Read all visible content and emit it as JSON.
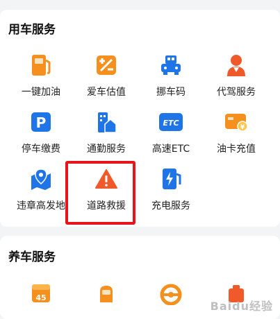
{
  "sections": {
    "car_services_title": "用车服务",
    "maintenance_title": "养车服务"
  },
  "car_services": [
    {
      "label": "一键加油",
      "icon": "fuel-pump-icon"
    },
    {
      "label": "爱车估值",
      "icon": "valuation-icon"
    },
    {
      "label": "挪车码",
      "icon": "move-car-code-icon"
    },
    {
      "label": "代驾服务",
      "icon": "chauffeur-icon"
    },
    {
      "label": "停车缴费",
      "icon": "parking-icon"
    },
    {
      "label": "通勤服务",
      "icon": "commute-icon"
    },
    {
      "label": "高速ETC",
      "icon": "etc-icon",
      "badge": "ETC"
    },
    {
      "label": "油卡充值",
      "icon": "fuel-card-icon"
    },
    {
      "label": "违章高发地",
      "icon": "violation-map-icon"
    },
    {
      "label": "道路救援",
      "icon": "road-rescue-icon"
    },
    {
      "label": "充电服务",
      "icon": "charging-icon"
    }
  ],
  "maintenance_services": [
    {
      "icon": "calendar-icon",
      "badge": "45"
    },
    {
      "icon": "car-wash-icon"
    },
    {
      "icon": "steering-wheel-icon"
    },
    {
      "icon": "repair-icon"
    }
  ],
  "colors": {
    "orange": "#f5901e",
    "blue": "#1f74e8",
    "red": "#e8141b",
    "rescue_red": "#f05a2a"
  },
  "watermark": "Baidu经验"
}
